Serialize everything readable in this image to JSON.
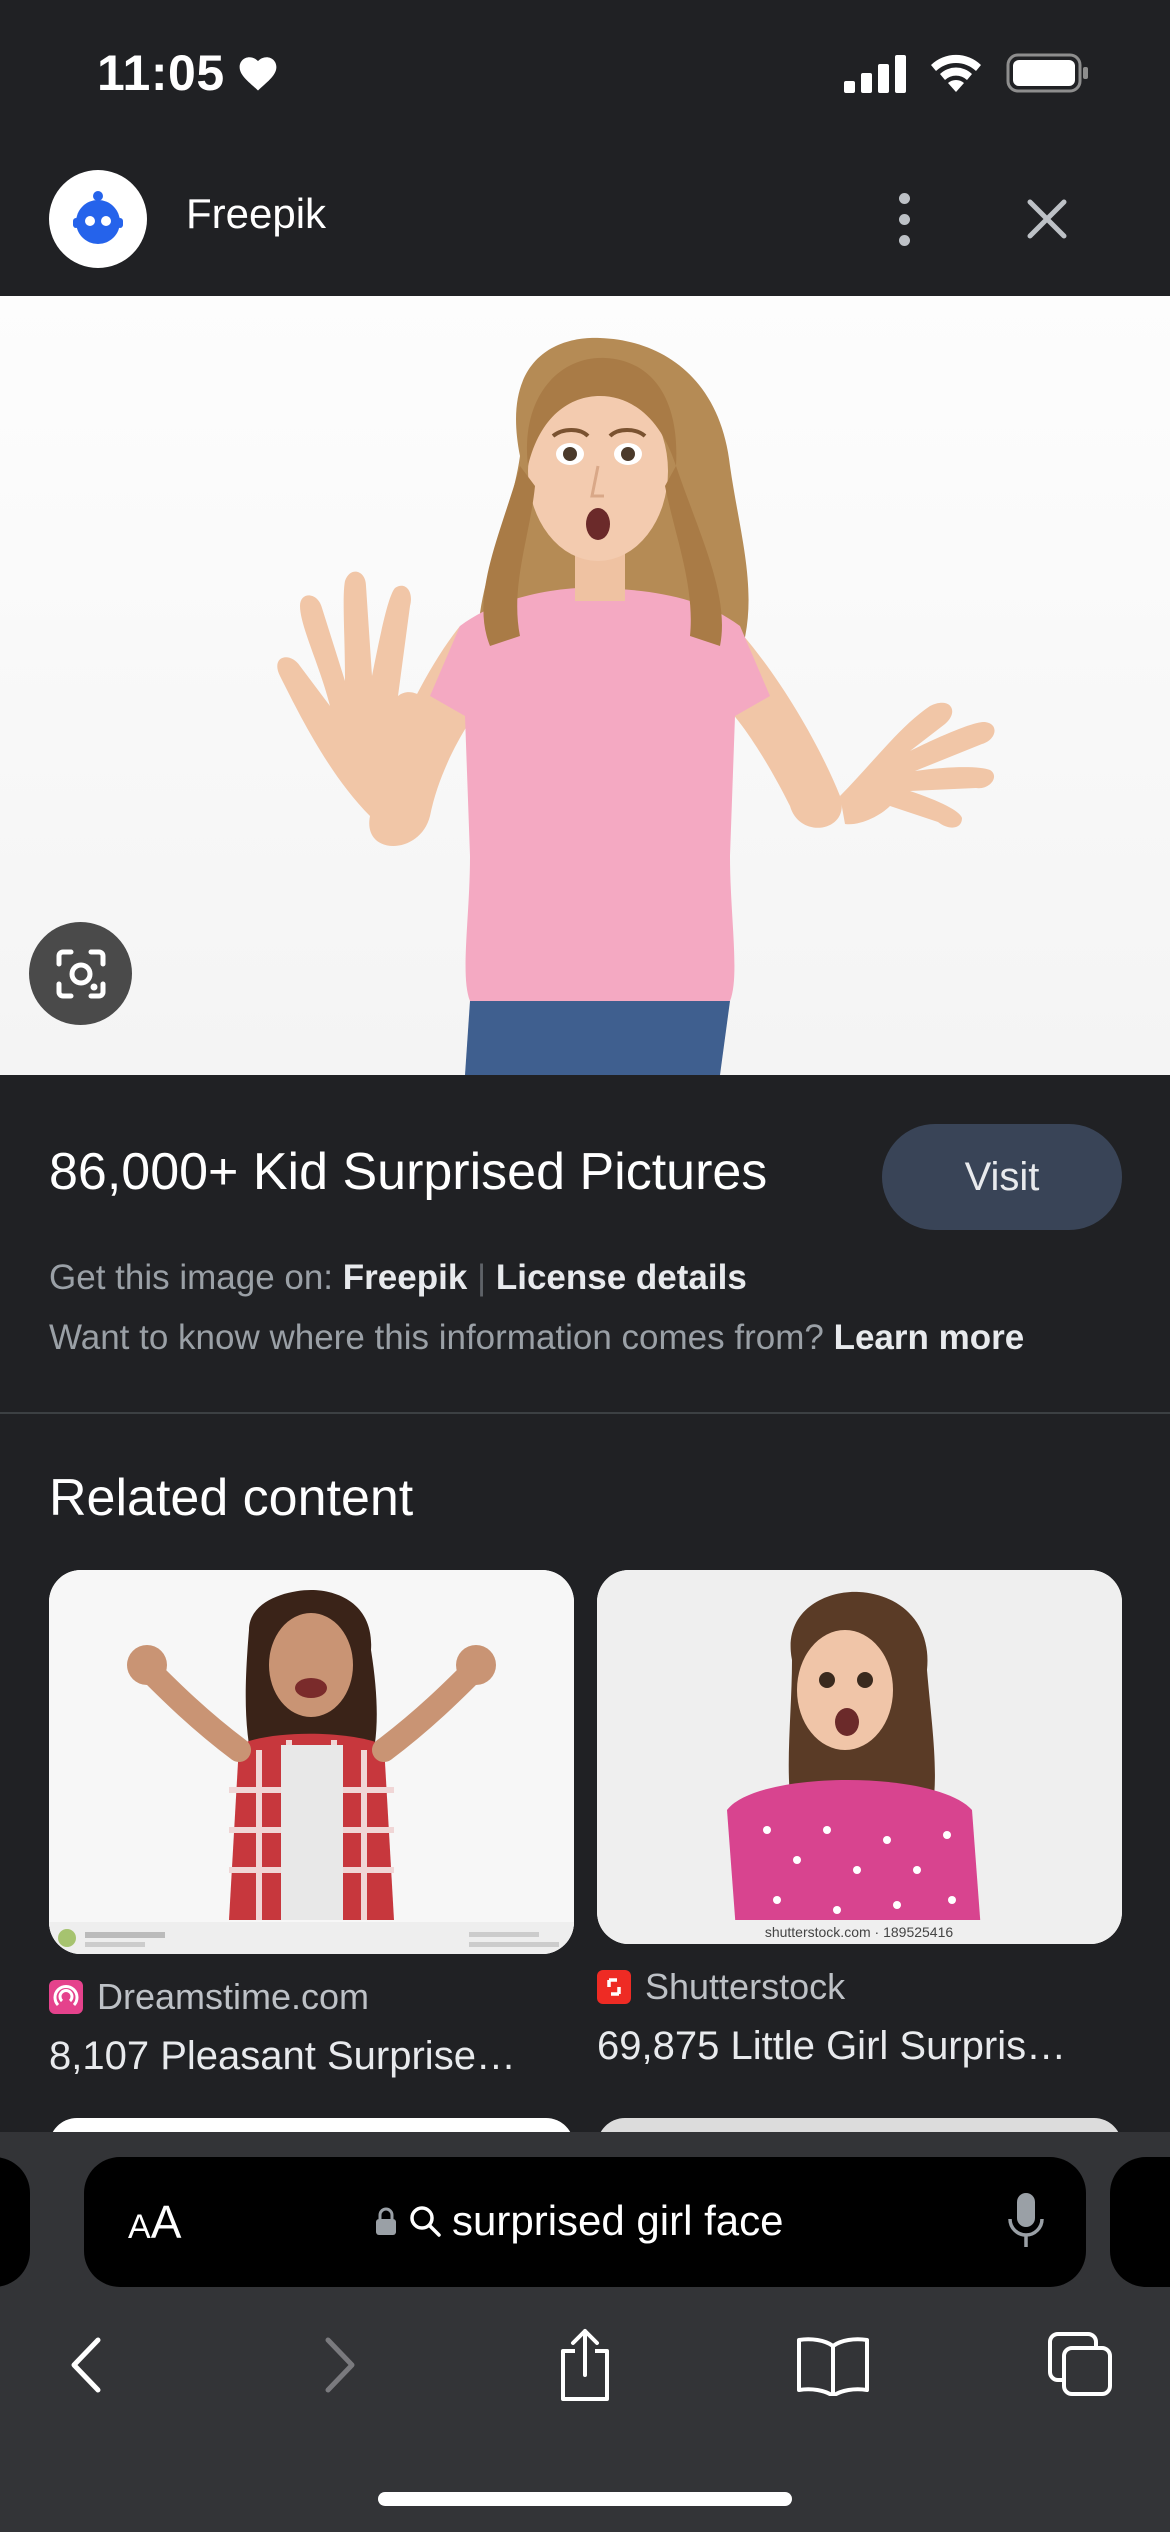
{
  "status_bar": {
    "time": "11:05"
  },
  "header": {
    "site_name": "Freepik"
  },
  "result": {
    "title": "86,000+ Kid Surprised Pictures",
    "visit_label": "Visit",
    "get_image_prefix": "Get this image on:",
    "source_link": "Freepik",
    "separator": "|",
    "license_link": "License details",
    "info_question": "Want to know where this information comes from?",
    "learn_more": "Learn more"
  },
  "related": {
    "heading": "Related content",
    "items": [
      {
        "source": "Dreamstime.com",
        "caption": "8,107 Pleasant Surprise…",
        "favicon_color": "#e5428c"
      },
      {
        "source": "Shutterstock",
        "caption": "69,875 Little Girl Surpris…",
        "watermark": "shutterstock.com · 189525416",
        "favicon_color": "#ee2b24"
      }
    ]
  },
  "address_bar": {
    "aa_label": "A",
    "aa_label_big": "A",
    "query": "surprised girl face"
  },
  "colors": {
    "background": "#202124",
    "visit_button": "#394457",
    "toolbar": "#333437"
  },
  "icons": [
    "heart-icon",
    "signal-icon",
    "wifi-icon",
    "battery-icon",
    "more-vert-icon",
    "close-icon",
    "lens-icon",
    "lock-icon",
    "search-icon",
    "mic-icon",
    "back-icon",
    "forward-icon",
    "share-icon",
    "bookmarks-icon",
    "tabs-icon"
  ]
}
